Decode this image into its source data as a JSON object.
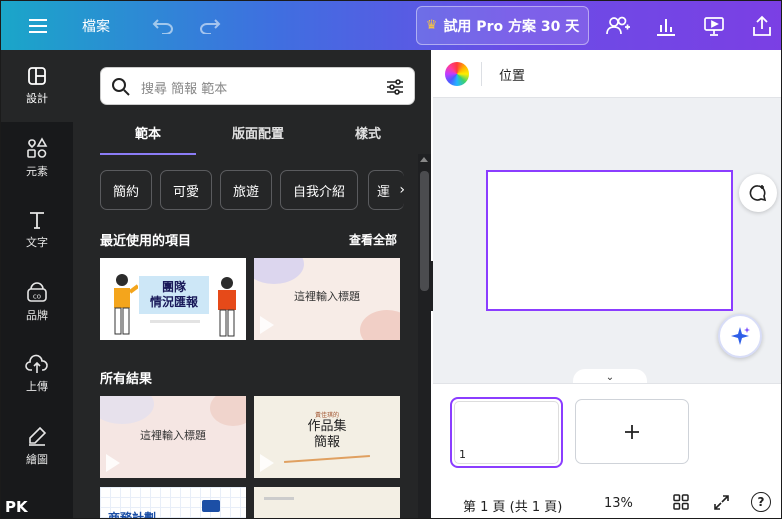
{
  "topbar": {
    "file_label": "檔案",
    "pro_button": "試用 Pro 方案 30 天"
  },
  "rail": {
    "items": [
      {
        "label": "設計",
        "icon": "layout-icon"
      },
      {
        "label": "元素",
        "icon": "shapes-icon"
      },
      {
        "label": "文字",
        "icon": "text-icon"
      },
      {
        "label": "品牌",
        "icon": "brand-icon"
      },
      {
        "label": "上傳",
        "icon": "cloud-upload-icon"
      },
      {
        "label": "繪圖",
        "icon": "draw-icon"
      }
    ]
  },
  "panel": {
    "search_placeholder": "搜尋 簡報 範本",
    "tabs": [
      "範本",
      "版面配置",
      "樣式"
    ],
    "chips": [
      "簡約",
      "可愛",
      "旅遊",
      "自我介紹",
      "運"
    ],
    "recent_title": "最近使用的項目",
    "see_all": "查看全部",
    "all_results_title": "所有結果",
    "templates": {
      "t1_title": "團隊\n情況匯報",
      "t2_title": "這裡輸入標題",
      "t3_title": "這裡輸入標題",
      "t4_small": "黃佳琪的",
      "t4_title": "作品集\n簡報",
      "t5_title": "商務計劃"
    }
  },
  "editor": {
    "context_label": "位置"
  },
  "pages": {
    "page_number": "1",
    "status": "第 1 頁 (共 1 頁)",
    "zoom": "13%"
  },
  "watermark": "PK"
}
